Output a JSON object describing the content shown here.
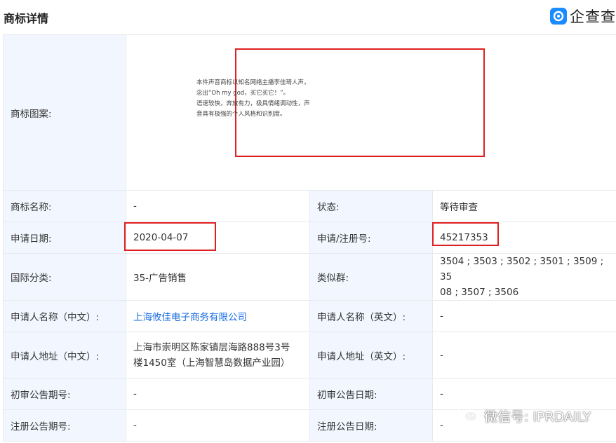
{
  "header": {
    "title": "商标详情",
    "brand": "企查查",
    "brand_icon": "qichacha-logo-icon"
  },
  "trademark_image": {
    "label": "商标图案:",
    "lines": [
      "本件声音商标以知名网络主播李佳琦人声，",
      "念出“Oh my god，买它买它！”。",
      "语速较快，奔放有力，极具情绪调动性，声",
      "音具有极强的个人风格和识别度。"
    ]
  },
  "rows": [
    {
      "l1": "商标名称:",
      "v1": "-",
      "l2": "状态:",
      "v2": "等待审查"
    },
    {
      "l1": "申请日期:",
      "v1": "2020-04-07",
      "l2": "申请/注册号:",
      "v2": "45217353"
    },
    {
      "l1": "国际分类:",
      "v1": "35-广告销售",
      "l2": "类似群:",
      "v2_lines": [
        "3504 ; 3503 ; 3502 ; 3501 ; 3509 ; 35",
        "08 ; 3507 ; 3506"
      ]
    },
    {
      "l1": "申请人名称（中文）:",
      "v1": "上海攸佳电子商务有限公司",
      "l2": "申请人名称（英文）:",
      "v2": "-"
    },
    {
      "l1": "申请人地址（中文）:",
      "v1_lines": [
        "上海市崇明区陈家镇层海路888号3号",
        "楼1450室（上海智慧岛数据产业园）"
      ],
      "l2": "申请人地址（英文）:",
      "v2": "-"
    },
    {
      "l1": "初审公告期号:",
      "v1": "-",
      "l2": "初审公告日期:",
      "v2": "-"
    },
    {
      "l1": "注册公告期号:",
      "v1": "-",
      "l2": "注册公告日期:",
      "v2": "-"
    }
  ],
  "watermark": {
    "text": "微信号: IPRDAILY",
    "icon": "wechat-icon"
  },
  "colors": {
    "label_bg": "#f2f7ff",
    "border": "#e6e9ee",
    "highlight": "#e02020",
    "link": "#1a6de0",
    "brand": "#1a8cff"
  }
}
